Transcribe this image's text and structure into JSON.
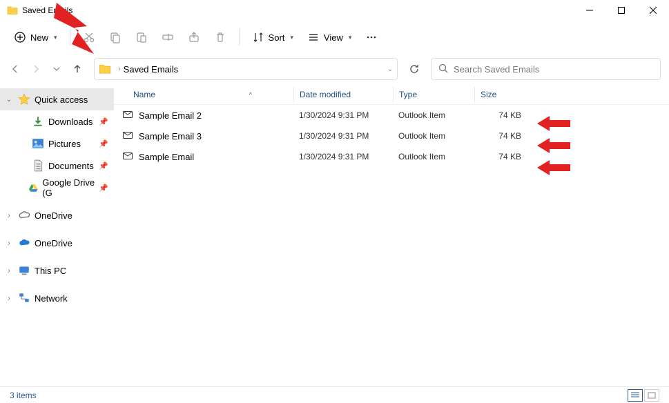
{
  "title": "Saved Emails",
  "toolbar": {
    "new_label": "New",
    "sort_label": "Sort",
    "view_label": "View"
  },
  "address": {
    "crumb": "Saved Emails"
  },
  "search": {
    "placeholder": "Search Saved Emails"
  },
  "sidebar": {
    "quick_access": "Quick access",
    "downloads": "Downloads",
    "pictures": "Pictures",
    "documents": "Documents",
    "google_drive": "Google Drive (G",
    "onedrive1": "OneDrive",
    "onedrive2": "OneDrive",
    "this_pc": "This PC",
    "network": "Network"
  },
  "columns": {
    "name": "Name",
    "date": "Date modified",
    "type": "Type",
    "size": "Size"
  },
  "rows": [
    {
      "name": "Sample Email 2",
      "date": "1/30/2024 9:31 PM",
      "type": "Outlook Item",
      "size": "74 KB"
    },
    {
      "name": "Sample Email 3",
      "date": "1/30/2024 9:31 PM",
      "type": "Outlook Item",
      "size": "74 KB"
    },
    {
      "name": "Sample Email",
      "date": "1/30/2024 9:31 PM",
      "type": "Outlook Item",
      "size": "74 KB"
    }
  ],
  "status": {
    "items": "3 items"
  }
}
